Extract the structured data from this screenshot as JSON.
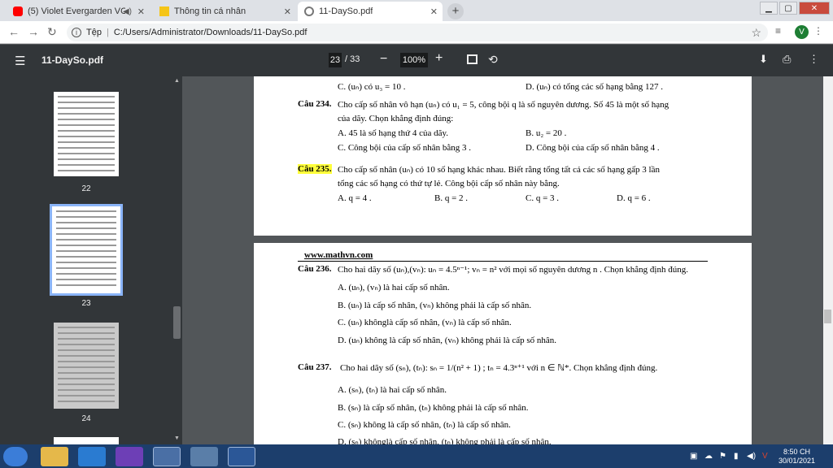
{
  "tabs": [
    {
      "label": "(5) Violet Evergarden VOCAL",
      "color": "#ff0000"
    },
    {
      "label": "Thông tin cá nhân",
      "color": "#f5c518"
    },
    {
      "label": "11-DaySo.pdf",
      "color": "#777777"
    }
  ],
  "address": {
    "scheme": "Tệp",
    "url": "C:/Users/Administrator/Downloads/11-DaySo.pdf"
  },
  "profile_initial": "V",
  "pdf": {
    "filename": "11-DaySo.pdf",
    "current_page": "23",
    "total_pages": "/ 33",
    "zoom": "100%"
  },
  "thumbnails": [
    {
      "number": "22"
    },
    {
      "number": "23"
    },
    {
      "number": "24"
    }
  ],
  "page1": {
    "line_c": "C. (uₙ) có u₃ = 10 .",
    "line_d": "D. (uₙ) có tổng các số hạng bằng 127 .",
    "q234_label": "Câu 234.",
    "q234_text": "Cho cấp số nhân vô hạn (uₙ) có u₁ = 5, công bội q là số nguyên dương. Số 45 là một số hạng",
    "q234_text2": "của dãy. Chọn khẳng định đúng:",
    "q234_a": "A. 45 là số hạng thứ 4 của dãy.",
    "q234_b": "B. u₂ = 20 .",
    "q234_c": "C. Công bội của cấp số nhân bằng 3 .",
    "q234_d": "D. Công bội của cấp số nhân bằng 4 .",
    "q235_label": "Câu 235.",
    "q235_text": "Cho cấp số nhân (uₙ) có 10 số hạng khác nhau. Biết rằng tổng tất cả các số hạng gấp 3 lần",
    "q235_text2": "tổng các số hạng có thứ tự lẻ. Công bội cấp số nhân này bằng.",
    "q235_a": "A. q = 4 .",
    "q235_b": "B. q = 2 .",
    "q235_c": "C. q = 3 .",
    "q235_d": "D. q = 6 ."
  },
  "page2": {
    "site": "www.mathvn.com",
    "q236_label": "Câu 236.",
    "q236_text": "Cho hai dãy số (uₙ),(vₙ): uₙ = 4.5ⁿ⁻¹; vₙ = n² với mọi số nguyên dương n . Chọn khẳng định đúng.",
    "q236_a": "A. (uₙ), (vₙ) là hai cấp số nhân.",
    "q236_b": "B. (uₙ) là cấp số nhân, (vₙ) không phải là cấp số nhân.",
    "q236_c": "C. (uₙ) khônglà cấp số nhân, (vₙ) là cấp số nhân.",
    "q236_d": "D. (uₙ) không là cấp số nhân, (vₙ) không phải là cấp số nhân.",
    "q237_label": "Câu 237.",
    "q237_text": "Cho hai dãy số (sₙ), (tₙ): sₙ = 1/(n² + 1) ; tₙ = 4.3ⁿ⁺¹ với n ∈ ℕ*. Chọn khẳng định đúng.",
    "q237_a": "A. (sₙ), (tₙ) là hai cấp số nhân.",
    "q237_b": "B. (sₙ) là cấp số nhân, (tₙ) không phải là cấp số nhân.",
    "q237_c": "C. (sₙ) không là cấp số nhân, (tₙ) là cấp số nhân.",
    "q237_d": "D. (sₙ) khônglà cấp số nhân, (tₙ) không phải là cấp số nhân."
  },
  "clock": {
    "time": "8:50 CH",
    "date": "30/01/2021"
  }
}
